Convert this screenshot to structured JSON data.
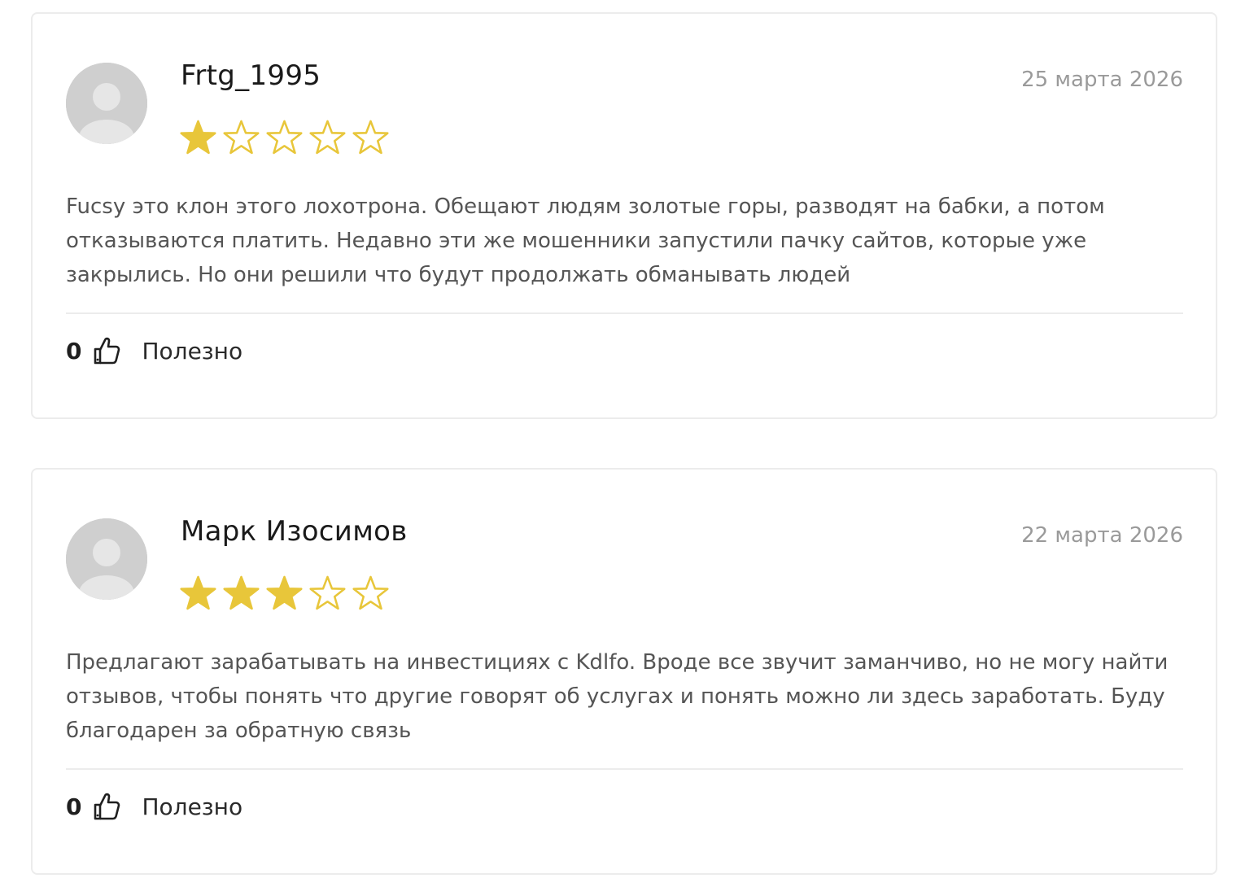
{
  "reviews": [
    {
      "author": "Frtg_1995",
      "date": "25 марта 2026",
      "rating": 1,
      "max_rating": 5,
      "text": "Fucsy это клон этого лохотрона. Обещают людям золотые горы, разводят на бабки, а потом отказываются платить. Недавно эти же мошенники запустили пачку сайтов, которые уже закрылись. Но они решили что будут продолжать обманывать людей",
      "likes": "0",
      "useful_label": "Полезно"
    },
    {
      "author": "Марк Изосимов",
      "date": "22 марта 2026",
      "rating": 3,
      "max_rating": 5,
      "text": "Предлагают зарабатывать на инвестициях с Kdlfo. Вроде все звучит заманчиво, но не могу найти отзывов, чтобы понять что другие говорят об услугах и понять можно ли здесь заработать. Буду благодарен за обратную связь",
      "likes": "0",
      "useful_label": "Полезно"
    }
  ],
  "colors": {
    "star_filled": "#e8c63a",
    "star_outline": "#e8c63a",
    "date_text": "#9a9a9a",
    "body_text": "#555555",
    "border": "#ececec"
  },
  "icons": {
    "avatar": "user-placeholder-icon",
    "star_filled": "star-filled-icon",
    "star_empty": "star-outline-icon",
    "like": "thumbs-up-icon"
  }
}
